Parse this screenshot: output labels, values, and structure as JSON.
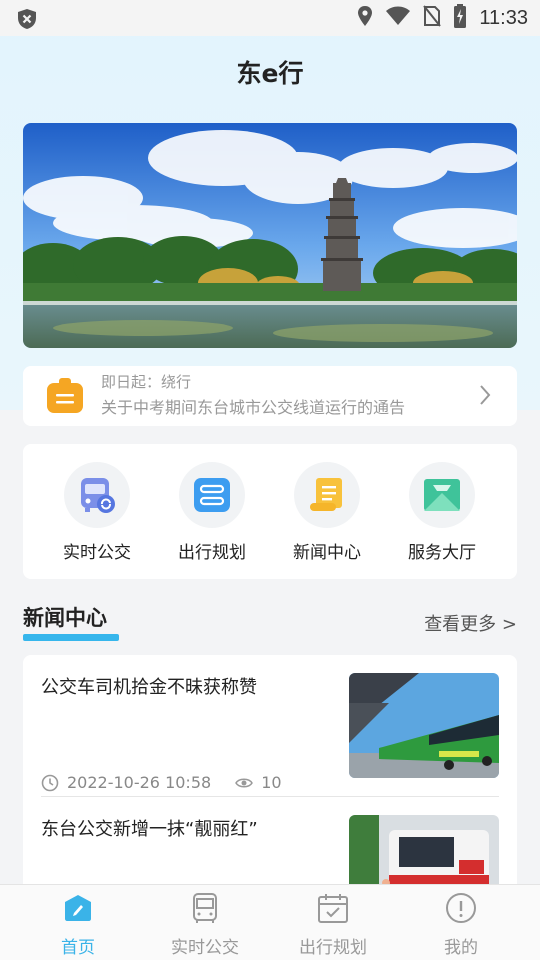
{
  "status_bar": {
    "time": "11:33"
  },
  "app": {
    "title": "东e行"
  },
  "notice": {
    "line1": "即日起：绕行",
    "line2": "关于中考期间东台城市公交线道运行的通告"
  },
  "quick_actions": [
    {
      "label": "实时公交",
      "icon": "bus-realtime-icon"
    },
    {
      "label": "出行规划",
      "icon": "route-plan-icon"
    },
    {
      "label": "新闻中心",
      "icon": "news-scroll-icon"
    },
    {
      "label": "服务大厅",
      "icon": "service-mail-icon"
    }
  ],
  "news_section": {
    "title": "新闻中心",
    "more_label": "查看更多 >",
    "items": [
      {
        "title": "公交车司机拾金不昧获称赞",
        "date": "2022-10-26 10:58",
        "views": "10"
      },
      {
        "title": "东台公交新增一抹“靓丽红”"
      }
    ]
  },
  "tabbar": [
    {
      "label": "首页",
      "active": true
    },
    {
      "label": "实时公交",
      "active": false
    },
    {
      "label": "出行规划",
      "active": false
    },
    {
      "label": "我的",
      "active": false
    }
  ],
  "colors": {
    "accent": "#36b6ec",
    "tab_active": "#3ab3e8",
    "notice_icon": "#f5a623"
  }
}
